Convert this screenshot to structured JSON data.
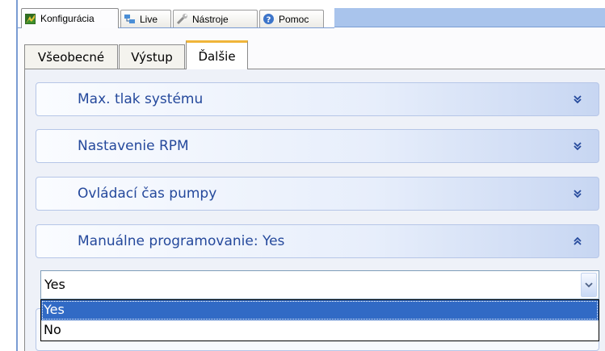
{
  "top_tabs": [
    {
      "label": "Konfigurácia",
      "icon": "config-icon",
      "active": true
    },
    {
      "label": "Live",
      "icon": "live-icon",
      "active": false
    },
    {
      "label": "Nástroje",
      "icon": "tools-icon",
      "active": false
    },
    {
      "label": "Pomoc",
      "icon": "help-icon",
      "active": false
    }
  ],
  "inner_tabs": [
    {
      "label": "Všeobecné",
      "active": false
    },
    {
      "label": "Výstup",
      "active": false
    },
    {
      "label": "Ďalšie",
      "active": true
    }
  ],
  "sections": [
    {
      "title": "Max. tlak systému",
      "expanded": false
    },
    {
      "title": "Nastavenie RPM",
      "expanded": false
    },
    {
      "title": "Ovládací čas pumpy",
      "expanded": false
    },
    {
      "title": "Manuálne programovanie: Yes",
      "expanded": true
    }
  ],
  "dropdown": {
    "value": "Yes",
    "options": [
      "Yes",
      "No"
    ],
    "highlighted": "Yes"
  },
  "colors": {
    "accent": "#25499c",
    "selection": "#316ac5",
    "active_tab_top": "#f0b53a"
  }
}
